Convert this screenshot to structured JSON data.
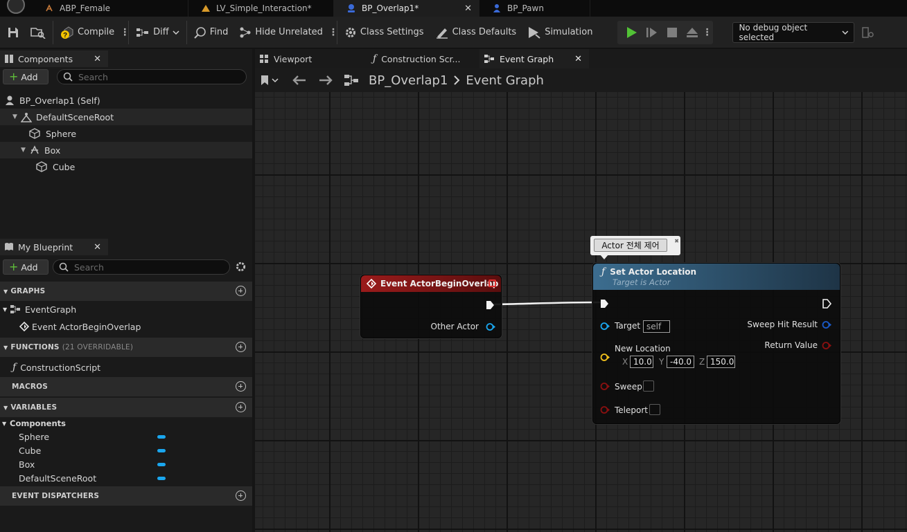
{
  "doc_tabs": [
    {
      "label": "ABP_Female",
      "icon": "animation-blueprint-icon"
    },
    {
      "label": "LV_Simple_Interaction*",
      "icon": "level-icon"
    },
    {
      "label": "BP_Overlap1*",
      "icon": "blueprint-icon",
      "active": true
    },
    {
      "label": "BP_Pawn",
      "icon": "pawn-icon"
    }
  ],
  "toolbar": {
    "compile": "Compile",
    "diff": "Diff",
    "find": "Find",
    "hide_unrelated": "Hide Unrelated",
    "class_settings": "Class Settings",
    "class_defaults": "Class Defaults",
    "simulation": "Simulation",
    "debug_object": "No debug object selected"
  },
  "components": {
    "title": "Components",
    "add": "Add",
    "search_placeholder": "Search",
    "items": [
      "BP_Overlap1 (Self)",
      "DefaultSceneRoot",
      "Sphere",
      "Box",
      "Cube"
    ]
  },
  "my_blueprint": {
    "title": "My Blueprint",
    "add": "Add",
    "search_placeholder": "Search",
    "graphs_header": "GRAPHS",
    "event_graph": "EventGraph",
    "event_item": "Event ActorBeginOverlap",
    "functions_header": "FUNCTIONS",
    "functions_count": "(21 OVERRIDABLE)",
    "construction_script": "ConstructionScript",
    "macros_header": "MACROS",
    "variables_header": "VARIABLES",
    "components_category": "Components",
    "variables": [
      "Sphere",
      "Cube",
      "Box",
      "DefaultSceneRoot"
    ],
    "dispatchers_header": "EVENT DISPATCHERS"
  },
  "graph_tabs": [
    "Viewport",
    "Construction Scr...",
    "Event Graph"
  ],
  "breadcrumb": {
    "root": "BP_Overlap1",
    "current": "Event Graph"
  },
  "event_node": {
    "title": "Event ActorBeginOverlap",
    "pin_other_actor": "Other Actor"
  },
  "comment_bubble": "Actor 전체 제어",
  "set_node": {
    "title": "Set Actor Location",
    "subtitle": "Target is Actor",
    "target_label": "Target",
    "target_value": "self",
    "new_location_label": "New Location",
    "x": "10.0",
    "y": "-40.0",
    "z": "150.0",
    "sweep_label": "Sweep",
    "teleport_label": "Teleport",
    "sweep_hit_result": "Sweep Hit Result",
    "return_value": "Return Value"
  },
  "colors": {
    "accent_green": "#5fbf3a",
    "object_pin": "#1aa6ee",
    "vector_pin": "#f2c11c",
    "bool_pin": "#8a1010",
    "event_header": "#8e1a1a",
    "function_header": "#3e6a8a"
  }
}
